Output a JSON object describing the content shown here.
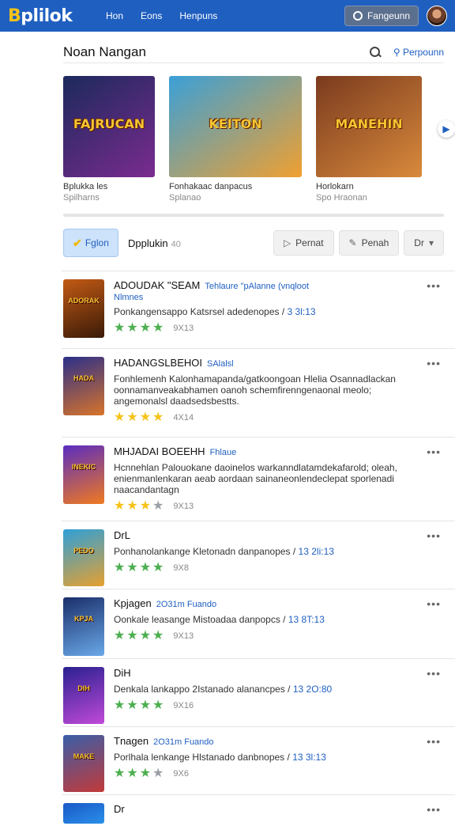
{
  "header": {
    "logo": "Bplilok",
    "nav": [
      "Hon",
      "Eons",
      "Henpuns"
    ],
    "button_label": "Fangeunn"
  },
  "section": {
    "title": "Noan Nangan",
    "link": "Perpounn"
  },
  "featured": [
    {
      "art": "FAJRUCAN",
      "title": "Bplukka les",
      "subtitle": "Spilharns",
      "colors": [
        "#1c2a5c",
        "#7a2b8f"
      ]
    },
    {
      "art": "KEITON",
      "title": "Fonhakaac danpacus",
      "subtitle": "Splanao",
      "colors": [
        "#3aa0d8",
        "#f0a030"
      ]
    },
    {
      "art": "MANEHIN",
      "title": "Horlokarn",
      "subtitle": "Spo Hraonan",
      "colors": [
        "#7a3a1e",
        "#d98a3c"
      ]
    }
  ],
  "toolbar": {
    "active_label": "Fglon",
    "tab_label": "Dpplukin",
    "tab_count": "40",
    "buttons": [
      "Pernat",
      "Penah",
      "Dr"
    ]
  },
  "games": [
    {
      "title": "ADOUDAK \"SEAM",
      "tag": "Tehlaure \"pAlanne (vnqloot",
      "sub": "Nlmnes",
      "desc": "Ponkangensappo Katsrsel adedenopes /",
      "meta": "3 3l:13",
      "stars": 4,
      "star_color": "#4caf50",
      "rating": "9X13",
      "thumb": "ADORAK",
      "colors": [
        "#c25a14",
        "#3a1a08"
      ],
      "height": 98
    },
    {
      "title": "HADANGSLBEHOI",
      "tag": "SAlalsl",
      "desc": "Fonhlemenh Kalonhamapanda/gatkoongoan Hlelia Osannadlackan oonnamanveakabhamen oanoh schemfirenngenaonal meolo; angemonalsl daadsedsbestts.",
      "meta": "",
      "stars": 4,
      "star_color": "#f6c21a",
      "rating": "4X14",
      "thumb": "HADA",
      "colors": [
        "#2b2f8a",
        "#d8742a"
      ],
      "height": 112
    },
    {
      "title": "MHJADAI BOEEHH",
      "tag": "Fhlaue",
      "desc": "Hcnnehlan Palouokane daoinelos warkanndlatamdekafarold; oleah, enienmanlenkaran aeab aordaan sainaneonlendeclepat sporlenadi naacandantagn",
      "meta": "",
      "stars": 3,
      "star_color": "#f6c21a",
      "rating": "9X13",
      "thumb": "INEKIC",
      "colors": [
        "#5a2cc0",
        "#f07a20"
      ],
      "height": 106
    },
    {
      "title": "DrL",
      "tag": "",
      "desc": "Ponhanolankange Kletonadn danpanopes /",
      "meta": "13 2li:13",
      "stars": 4,
      "star_color": "#4caf50",
      "rating": "9X8",
      "thumb": "PEDO",
      "colors": [
        "#2ea0d8",
        "#e6a030"
      ],
      "height": 86
    },
    {
      "title": "Kpjagen",
      "tag": "2O31m Fuando",
      "desc": "Oonkale leasange Mistoadaa danpopcs /",
      "meta": "13 8T:13",
      "stars": 4,
      "star_color": "#4caf50",
      "rating": "9X13",
      "thumb": "KPJA",
      "colors": [
        "#1a2f6a",
        "#6aa8e8"
      ],
      "height": 88
    },
    {
      "title": "DiH",
      "tag": "",
      "desc": "Denkala lankappo 2Istanado alanancpes /",
      "meta": "13 2O:80",
      "stars": 4,
      "star_color": "#4caf50",
      "rating": "9X16",
      "thumb": "DIH",
      "colors": [
        "#2a2090",
        "#c04ad8"
      ],
      "height": 86
    },
    {
      "title": "Tnagen",
      "tag": "2O31m Fuando",
      "desc": "Porlhala lenkange Hlstanado danbnopes /",
      "meta": "13 3l:13",
      "stars": 3,
      "star_color": "#4caf50",
      "rating": "9X6",
      "thumb": "MAKE",
      "colors": [
        "#3a5ea8",
        "#c23a3a"
      ],
      "height": 86
    },
    {
      "title": "Dr",
      "tag": "",
      "desc": "",
      "meta": "",
      "stars": 0,
      "star_color": "#4caf50",
      "rating": "",
      "thumb": "",
      "colors": [
        "#1a58c8",
        "#2a90e8"
      ],
      "height": 40
    }
  ]
}
